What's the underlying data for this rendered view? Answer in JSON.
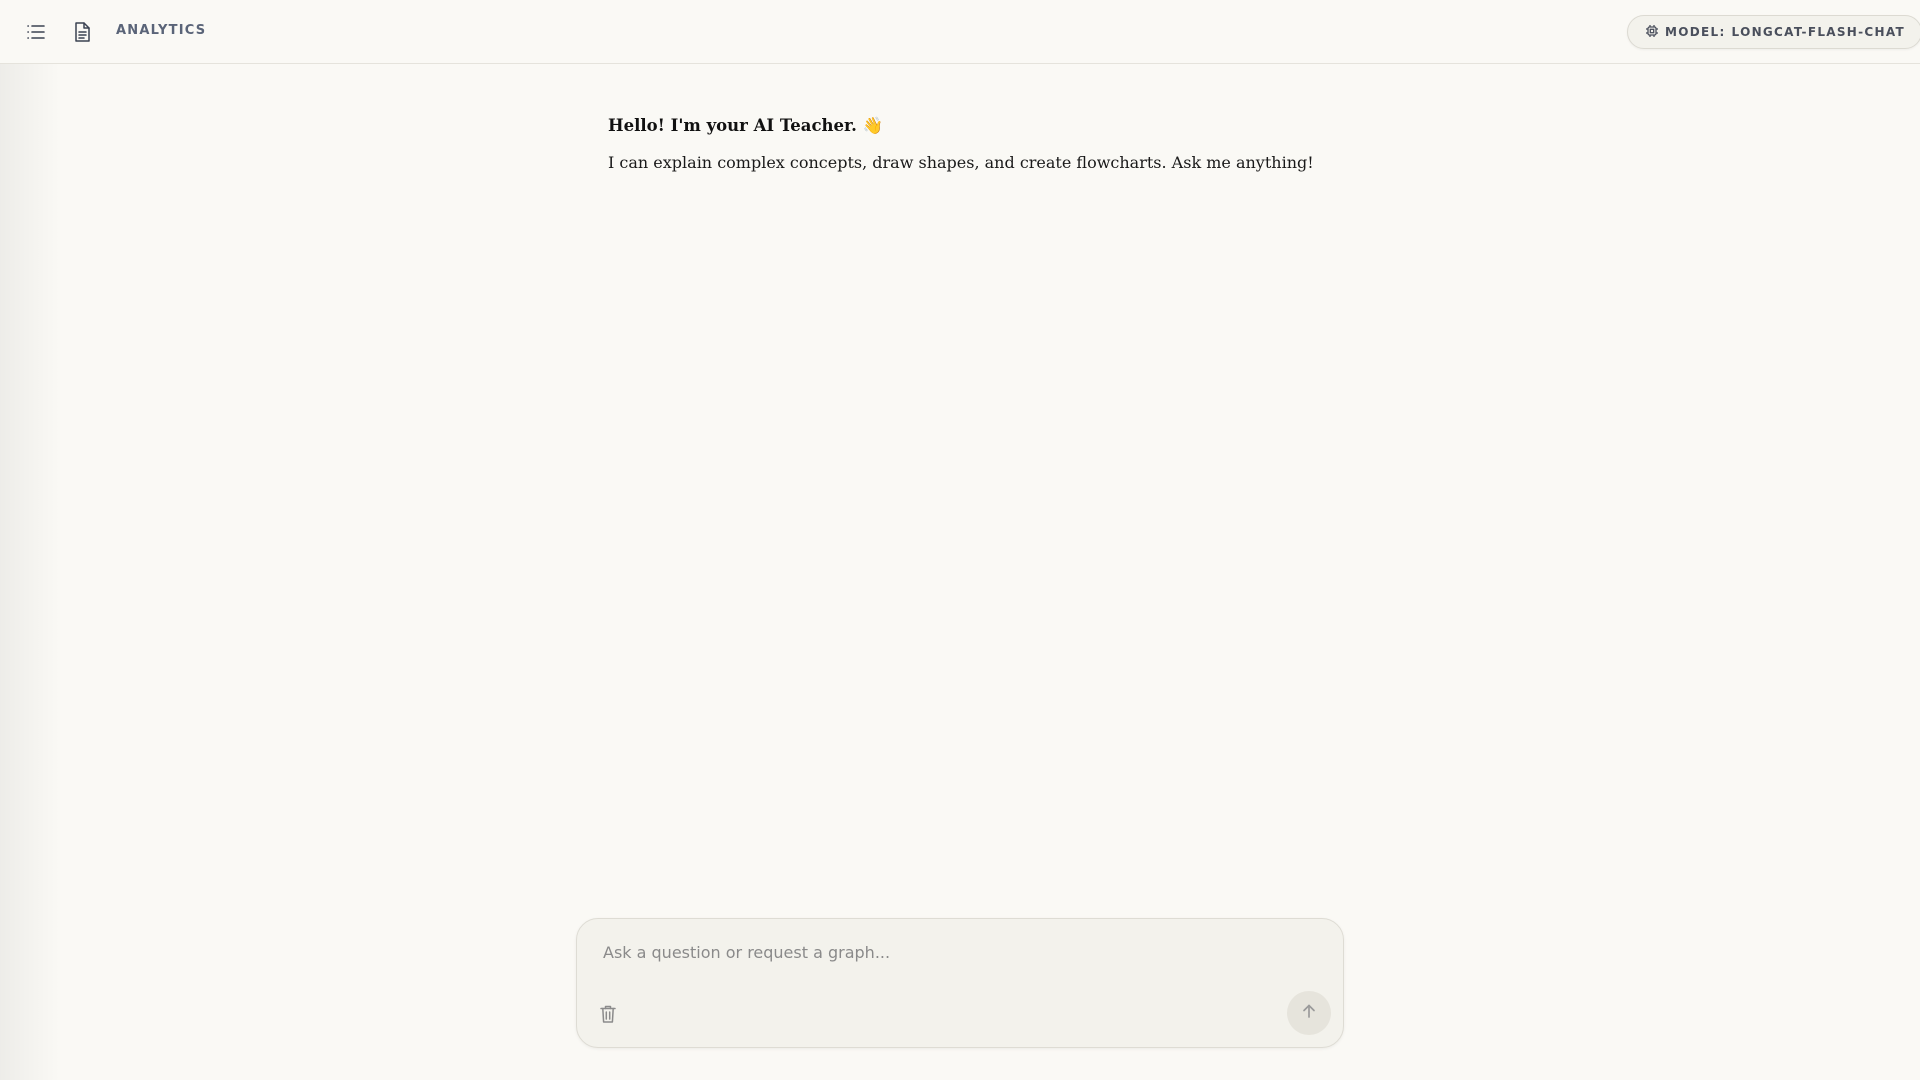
{
  "header": {
    "page_label": "ANALYTICS",
    "model_label": "MODEL:",
    "model_name": "LONGCAT-FLASH-CHAT",
    "icons": [
      "menu-list-icon",
      "document-icon",
      "chip-icon"
    ]
  },
  "chat": {
    "greeting": "Hello! I'm your AI Teacher. 👋",
    "intro": "I can explain complex concepts, draw shapes, and create flowcharts. Ask me anything!"
  },
  "composer": {
    "placeholder": "Ask a question or request a graph...",
    "value": "",
    "icons": [
      "trash-icon",
      "arrow-up-icon"
    ]
  },
  "colors": {
    "background": "#faf9f5",
    "composer_bg": "#f3f2ec",
    "label": "#5a6478",
    "send_button_bg": "#e6e4dc"
  }
}
